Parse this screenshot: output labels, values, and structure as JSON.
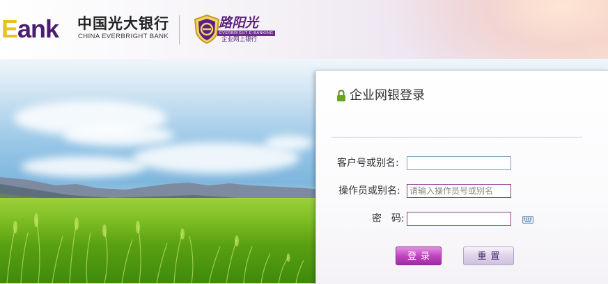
{
  "header": {
    "ebank_logo_e": "E",
    "ebank_logo_rest": "ank",
    "bank_name_cn": "中国光大银行",
    "bank_name_en": "CHINA EVERBRIGHT BANK",
    "sunlight_brand_cn": "路阳光",
    "sunlight_brand_en": "EVERBRIGHT E-BANKING",
    "sunlight_sub": "企业网上银行"
  },
  "login": {
    "title": "企业网银登录",
    "customer_label": "客户号或别名:",
    "customer_value": "",
    "operator_label": "操作员或别名:",
    "operator_placeholder": "请输入操作员号或别名",
    "password_label": "密　码:",
    "password_value": "",
    "login_button": "登录",
    "reset_button": "重置"
  },
  "colors": {
    "brand_purple": "#4a1d6e",
    "brand_yellow": "#e8c21a",
    "login_button": "#c046bf"
  },
  "icons": {
    "lock": "lock-icon",
    "keyboard": "keyboard-icon"
  }
}
